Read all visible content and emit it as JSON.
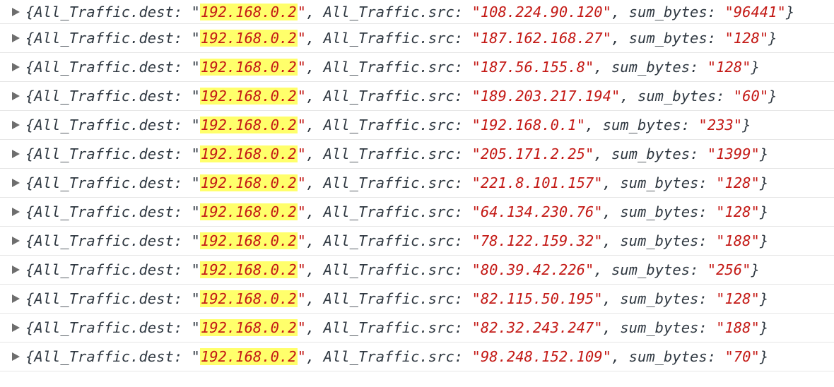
{
  "console": {
    "keys": {
      "dest": "All_Traffic.dest",
      "src": "All_Traffic.src",
      "bytes": "sum_bytes"
    },
    "rows": [
      {
        "dest": "192.168.0.2",
        "src": "108.224.90.120",
        "sum_bytes": "96441"
      },
      {
        "dest": "192.168.0.2",
        "src": "187.162.168.27",
        "sum_bytes": "128"
      },
      {
        "dest": "192.168.0.2",
        "src": "187.56.155.8",
        "sum_bytes": "128"
      },
      {
        "dest": "192.168.0.2",
        "src": "189.203.217.194",
        "sum_bytes": "60"
      },
      {
        "dest": "192.168.0.2",
        "src": "192.168.0.1",
        "sum_bytes": "233"
      },
      {
        "dest": "192.168.0.2",
        "src": "205.171.2.25",
        "sum_bytes": "1399"
      },
      {
        "dest": "192.168.0.2",
        "src": "221.8.101.157",
        "sum_bytes": "128"
      },
      {
        "dest": "192.168.0.2",
        "src": "64.134.230.76",
        "sum_bytes": "128"
      },
      {
        "dest": "192.168.0.2",
        "src": "78.122.159.32",
        "sum_bytes": "188"
      },
      {
        "dest": "192.168.0.2",
        "src": "80.39.42.226",
        "sum_bytes": "256"
      },
      {
        "dest": "192.168.0.2",
        "src": "82.115.50.195",
        "sum_bytes": "128"
      },
      {
        "dest": "192.168.0.2",
        "src": "82.32.243.247",
        "sum_bytes": "188"
      },
      {
        "dest": "192.168.0.2",
        "src": "98.248.152.109",
        "sum_bytes": "70"
      }
    ]
  }
}
